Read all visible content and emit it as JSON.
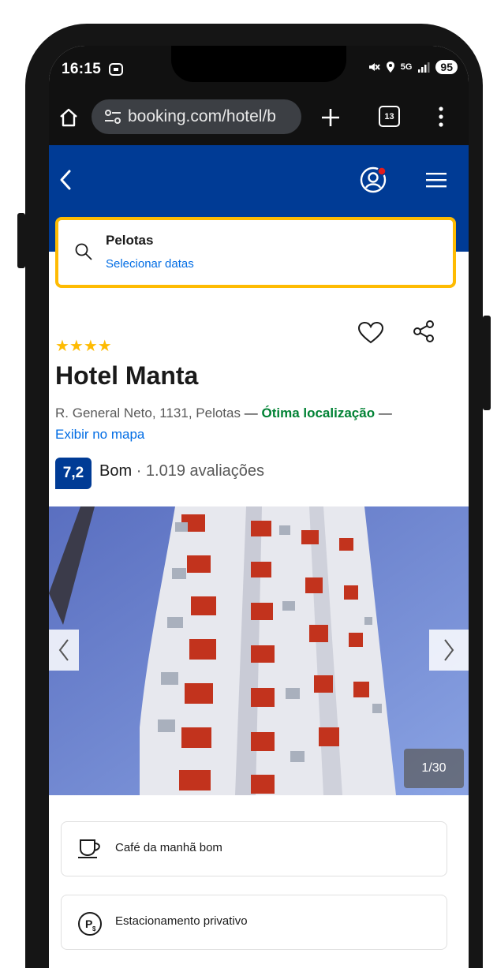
{
  "status_bar": {
    "time": "16:15",
    "network": "5G",
    "battery": "95"
  },
  "browser": {
    "url": "booking.com/hotel/b",
    "tab_count": "13"
  },
  "search": {
    "destination": "Pelotas",
    "dates_link": "Selecionar datas"
  },
  "hotel": {
    "name": "Hotel Manta",
    "stars": "★★★★",
    "star_count": 4,
    "address": "R. General Neto, 1131, Pelotas",
    "dash": "—",
    "location_highlight": "Ótima localização",
    "map_link": "Exibir no mapa",
    "score": "7,2",
    "score_label": "Bom",
    "reviews": "· 1.019 avaliações"
  },
  "gallery": {
    "counter": "1/30"
  },
  "facilities": [
    {
      "icon": "coffee-cup-icon",
      "label": "Café da manhã bom"
    },
    {
      "icon": "parking-icon",
      "label": "Estacionamento privativo"
    }
  ],
  "colors": {
    "brand": "#003b95",
    "accent": "#febb02",
    "link": "#006ce4",
    "success": "#008234"
  }
}
